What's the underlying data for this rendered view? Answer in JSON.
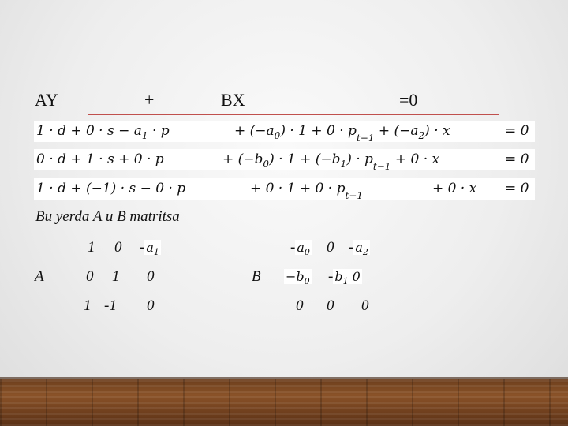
{
  "header": {
    "ay": "AY",
    "plus": "+",
    "bx": "BX",
    "eq": "=0"
  },
  "equations": [
    {
      "c1_pre": "1 · d + 0 · s − a",
      "c1_sub": "1",
      "c1_post": " · p",
      "c2_pre": "+ (−a",
      "c2_sub": "0",
      "c2_mid": ") · 1 + 0 · p",
      "c2_subt": "t−1",
      "c3_pre": " + (−a",
      "c3_sub": "2",
      "c3_post": ") · x",
      "rhs": "= 0"
    },
    {
      "c1_pre": "0 · d + 1 · s + 0 · p",
      "c2_pre": "+ (−b",
      "c2_sub": "0",
      "c2_mid": ") · 1 + (−b",
      "c2_sub2": "1",
      "c2_mid2": ") · p",
      "c2_subt": "t−1",
      "c3_pre": " + 0 · x",
      "rhs": "= 0"
    },
    {
      "c1_pre": "1 · d + (−1) · s − 0 · p",
      "c2_pre": "+ 0 · 1 + 0 · p",
      "c2_subt": "t−1",
      "c3_pre": "+ 0 · x",
      "rhs": "= 0"
    }
  ],
  "note": "Bu yerda  A u B matritsa",
  "matrixA": {
    "label": "A",
    "row1": [
      "1",
      "0",
      "-"
    ],
    "row1_box_var": "a",
    "row1_box_sub": "1",
    "row2": [
      "0",
      "1",
      "0"
    ],
    "row3": [
      "1",
      "-1",
      "0"
    ]
  },
  "matrixB": {
    "label": "B",
    "row1_minus1": "-",
    "row1_box1_var": "a",
    "row1_box1_sub": "0",
    "row1_mid": "0",
    "row1_minus2": "-",
    "row1_box2_var": "a",
    "row1_box2_sub": "2",
    "row2_box1": "−b",
    "row2_box1_sub": "0",
    "row2_minus": "-",
    "row2_box2_var": "b",
    "row2_box2_sub": "1",
    "row2_box2_post": " 0",
    "row3": [
      "0",
      "0",
      "0"
    ]
  }
}
